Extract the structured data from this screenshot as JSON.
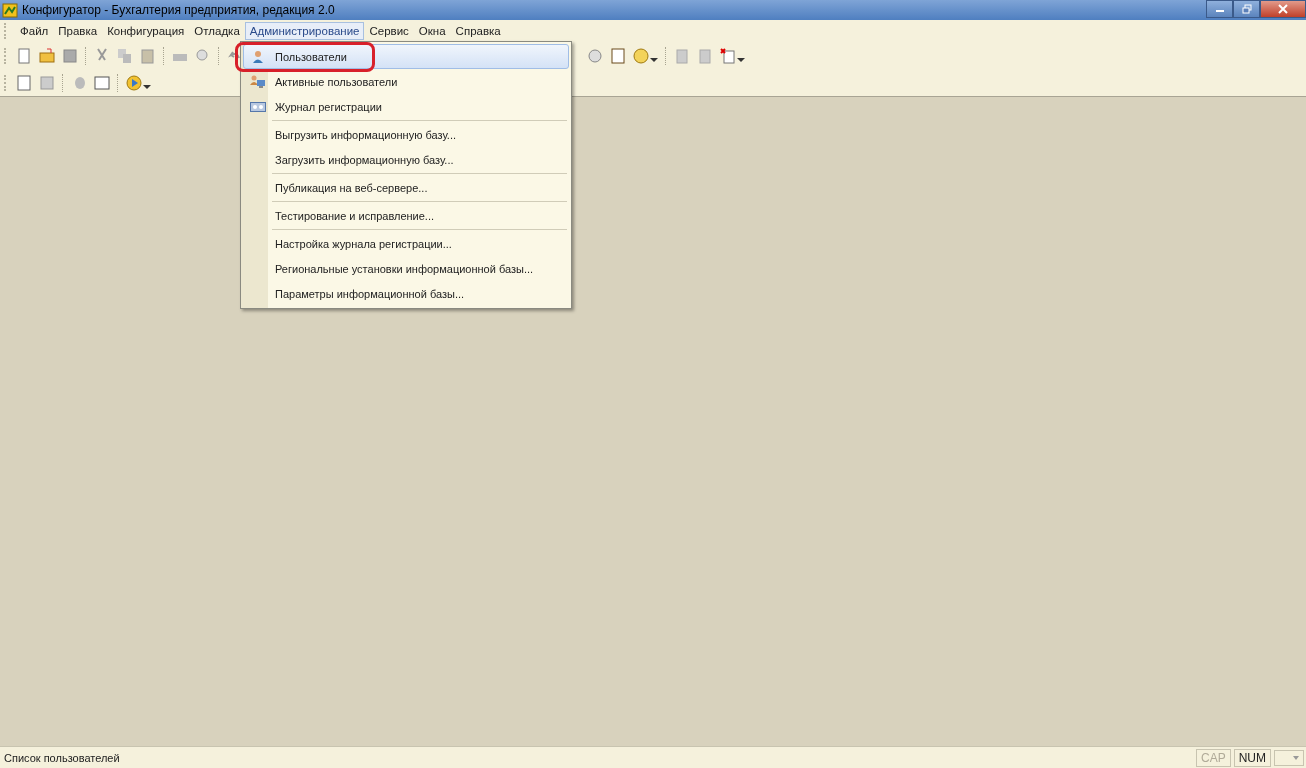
{
  "window": {
    "title": "Конфигуратор - Бухгалтерия предприятия, редакция 2.0"
  },
  "menu_bar": [
    {
      "label": "Файл",
      "selected": false
    },
    {
      "label": "Правка",
      "selected": false
    },
    {
      "label": "Конфигурация",
      "selected": false
    },
    {
      "label": "Отладка",
      "selected": false
    },
    {
      "label": "Администрирование",
      "selected": true
    },
    {
      "label": "Сервис",
      "selected": false
    },
    {
      "label": "Окна",
      "selected": false
    },
    {
      "label": "Справка",
      "selected": false
    }
  ],
  "dropdown_groups": [
    [
      {
        "label": "Пользователи",
        "kind": "user",
        "selected": true
      },
      {
        "label": "Активные пользователи",
        "kind": "active-users",
        "selected": false
      },
      {
        "label": "Журнал регистрации",
        "kind": "log",
        "selected": false
      }
    ],
    [
      {
        "label": "Выгрузить информационную базу...",
        "kind": "plain",
        "selected": false
      },
      {
        "label": "Загрузить информационную базу...",
        "kind": "plain",
        "selected": false
      }
    ],
    [
      {
        "label": "Публикация на веб-сервере...",
        "kind": "plain",
        "selected": false
      }
    ],
    [
      {
        "label": "Тестирование и исправление...",
        "kind": "plain",
        "selected": false
      }
    ],
    [
      {
        "label": "Настройка журнала регистрации...",
        "kind": "plain",
        "selected": false
      },
      {
        "label": "Региональные установки информационной базы...",
        "kind": "plain",
        "selected": false
      },
      {
        "label": "Параметры информационной базы...",
        "kind": "plain",
        "selected": false
      }
    ]
  ],
  "status_bar": {
    "message": "Список пользователей",
    "indicators": [
      {
        "label": "CAP",
        "on": false
      },
      {
        "label": "NUM",
        "on": true
      }
    ]
  }
}
